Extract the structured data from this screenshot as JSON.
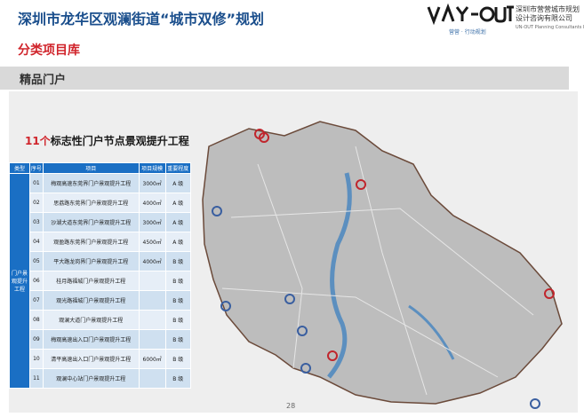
{
  "header": {
    "title": "深圳市龙华区观澜街道“城市双修”规划",
    "logo_sub": "营营 · 行动规划",
    "company_cn": "深圳市营营城市规划设计咨询有限公司",
    "company_en": "UN-OUT Planning Consultants Ltd"
  },
  "section_title": "分类项目库",
  "subsection_title": "精品门户",
  "headline": {
    "num": "11个",
    "rest": "标志性门户节点景观提升工程"
  },
  "table": {
    "headers": [
      "类型",
      "序号",
      "项目",
      "项目规模",
      "重要程度"
    ],
    "category": "门户景观提升工程",
    "rows": [
      [
        "01",
        "梅观高速东莞界门户景观提升工程",
        "3000㎡",
        "A 级"
      ],
      [
        "02",
        "思荔路东莞界门户景观提升工程",
        "4000㎡",
        "A 级"
      ],
      [
        "03",
        "沙湖大道东莞界门户景观提升工程",
        "3000㎡",
        "A 级"
      ],
      [
        "04",
        "观盈路东莞界门户景观提升工程",
        "4500㎡",
        "A 级"
      ],
      [
        "05",
        "平大路龙岗界门户景观提升工程",
        "4000㎡",
        "B 级"
      ],
      [
        "06",
        "桂月路福城门户景观提升工程",
        "",
        "B 级"
      ],
      [
        "07",
        "观光路福城门户景观提升工程",
        "",
        "B 级"
      ],
      [
        "08",
        "观澜大道门户景观提升工程",
        "",
        "B 级"
      ],
      [
        "09",
        "梅观高速出入口门户景观提升工程",
        "",
        "B 级"
      ],
      [
        "10",
        "清平高速出入口门户景观提升工程",
        "6000㎡",
        "B 级"
      ],
      [
        "11",
        "观澜中心站门户景观提升工程",
        "",
        "B 级"
      ]
    ]
  },
  "page_number": "28"
}
